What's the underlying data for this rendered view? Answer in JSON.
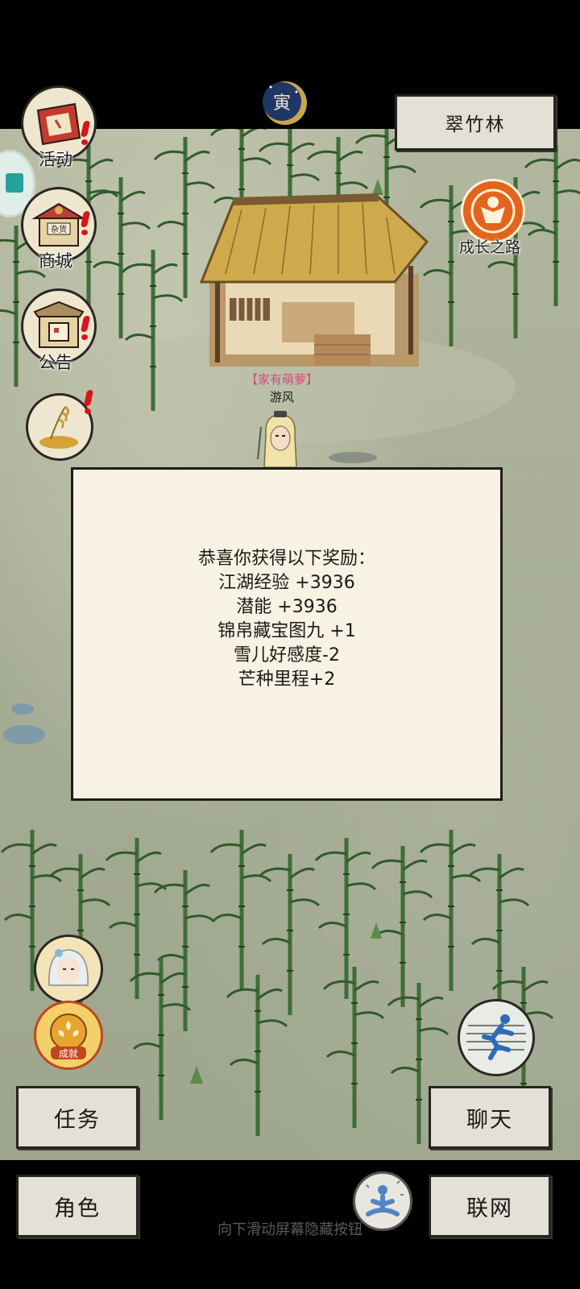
{
  "header": {
    "location_label": "翠竹林",
    "time_icon": "tiger-zodiac-moon-icon",
    "time_char": "寅"
  },
  "left_menu": [
    {
      "label": "活动",
      "icon": "event-banner-icon",
      "badge": true
    },
    {
      "label": "商城",
      "icon": "shop-stall-icon",
      "sign": "杂货",
      "badge": true
    },
    {
      "label": "公告",
      "icon": "notice-board-icon",
      "badge": true
    },
    {
      "label": "",
      "icon": "harvest-grain-icon",
      "badge": true
    }
  ],
  "growth_path": {
    "label": "成长之路",
    "icon": "growth-figure-icon"
  },
  "npc": {
    "tag": "【家有萌萝】",
    "name": "游风"
  },
  "reward_dialog": {
    "heading": "恭喜你获得以下奖励：",
    "rewards": [
      "江湖经验 +3936",
      "潜能 +3936",
      "锦帛藏宝图九 +1",
      "雪儿好感度-2",
      "芒种里程+2"
    ]
  },
  "companion": {
    "icon": "companion-portrait-icon"
  },
  "achievement": {
    "label": "成就",
    "icon": "achievement-medal-icon"
  },
  "auto_walk": {
    "icon": "running-figure-icon"
  },
  "meditate": {
    "icon": "meditation-figure-icon"
  },
  "bottom_buttons": {
    "task": "任务",
    "chat": "聊天",
    "role": "角色",
    "online": "联网"
  },
  "footer_hint": "向下滑动屏幕隐藏按钮",
  "colors": {
    "map_bg": "#a9ae97",
    "dialog_bg": "#f8f2e4",
    "button_bg": "#e3e0d6",
    "badge_red": "#d8141a",
    "npc_tag_pink": "#d8487d",
    "growth_orange": "#e3641c"
  }
}
